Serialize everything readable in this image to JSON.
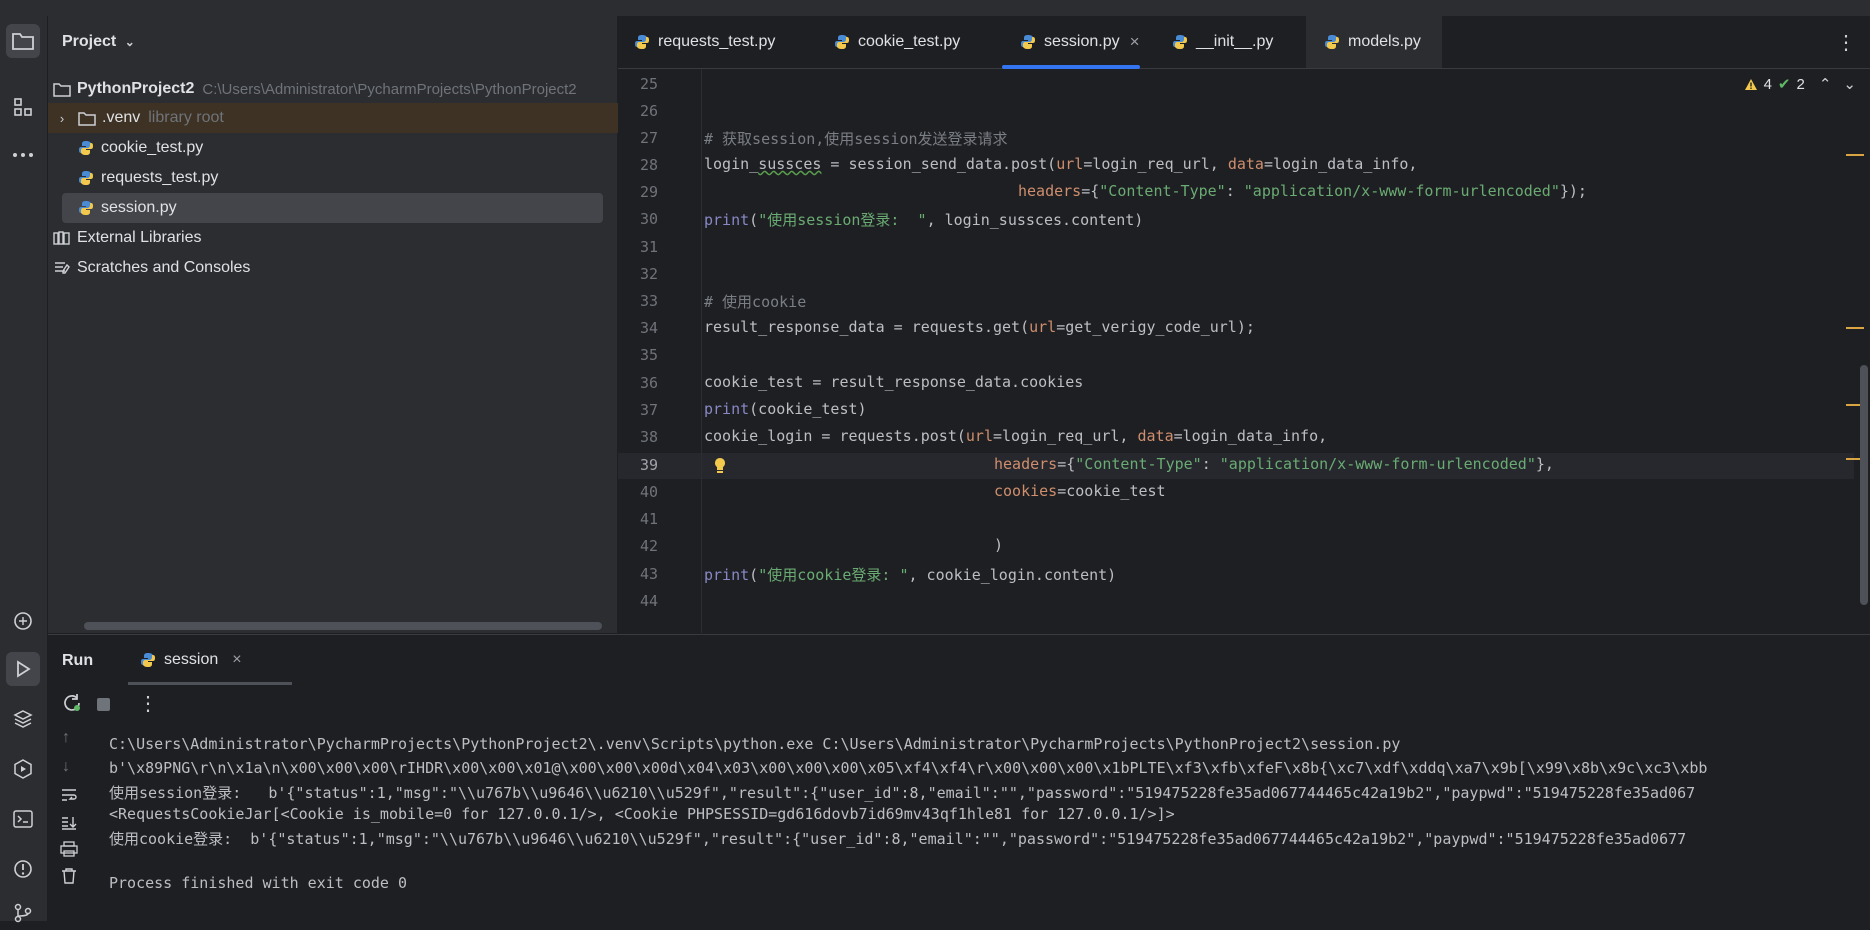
{
  "project": {
    "header": "Project",
    "root": {
      "name": "PythonProject2",
      "path": "C:\\Users\\Administrator\\PycharmProjects\\PythonProject2"
    },
    "items": [
      {
        "label": ".venv",
        "hint": "library root"
      },
      {
        "label": "cookie_test.py"
      },
      {
        "label": "requests_test.py"
      },
      {
        "label": "session.py"
      }
    ],
    "external": "External Libraries",
    "scratches": "Scratches and Consoles"
  },
  "tabs": [
    {
      "label": "requests_test.py"
    },
    {
      "label": "cookie_test.py"
    },
    {
      "label": "session.py",
      "close": "×"
    },
    {
      "label": "__init__.py"
    },
    {
      "label": "models.py"
    }
  ],
  "more_glyph": "⋮",
  "inspections": {
    "warnings": "4",
    "ok": "2"
  },
  "line_numbers": [
    "25",
    "26",
    "27",
    "28",
    "29",
    "30",
    "31",
    "32",
    "33",
    "34",
    "35",
    "36",
    "37",
    "38",
    "39",
    "40",
    "41",
    "42",
    "43",
    "44"
  ],
  "code": {
    "l27": "# 获取session,使用session发送登录请求",
    "l28_a": "login_",
    "l28_b": "sussces",
    "l28_c": " = session_send_data.post(",
    "l28_d": "url",
    "l28_e": "=login_req_url, ",
    "l28_f": "data",
    "l28_g": "=login_data_info,",
    "l29_a": "headers",
    "l29_b": "={",
    "l29_c": "\"Content-Type\"",
    "l29_d": ": ",
    "l29_e": "\"application/x-www-form-urlencoded\"",
    "l29_f": "});",
    "l30_a": "print",
    "l30_b": "(",
    "l30_c": "\"使用session登录:  \"",
    "l30_d": ", login_sussces.content)",
    "l33": "# 使用cookie",
    "l34_a": "result_response_data = requests.get(",
    "l34_b": "url",
    "l34_c": "=get_verigy_code_url);",
    "l36": "cookie_test = result_response_data.cookies",
    "l37_a": "print",
    "l37_b": "(cookie_test)",
    "l38_a": "cookie_login = requests.post(",
    "l38_b": "url",
    "l38_c": "=login_req_url, ",
    "l38_d": "data",
    "l38_e": "=login_data_info,",
    "l39_a": "headers",
    "l39_b": "={",
    "l39_c": "\"Content-Type\"",
    "l39_d": ": ",
    "l39_e": "\"application/x-www-form-urlencoded\"",
    "l39_f": "},",
    "l40_a": "cookies",
    "l40_b": "=cookie_test",
    "l42": ")",
    "l43_a": "print",
    "l43_b": "(",
    "l43_c": "\"使用cookie登录: \"",
    "l43_d": ", cookie_login.content)"
  },
  "run": {
    "title": "Run",
    "tab": "session",
    "close": "×",
    "output": [
      "C:\\Users\\Administrator\\PycharmProjects\\PythonProject2\\.venv\\Scripts\\python.exe C:\\Users\\Administrator\\PycharmProjects\\PythonProject2\\session.py",
      "b'\\x89PNG\\r\\n\\x1a\\n\\x00\\x00\\x00\\rIHDR\\x00\\x00\\x01@\\x00\\x00\\x00d\\x04\\x03\\x00\\x00\\x00\\x05\\xf4\\xf4\\r\\x00\\x00\\x00\\x1bPLTE\\xf3\\xfb\\xfeF\\x8b{\\xc7\\xdf\\xddq\\xa7\\x9b[\\x99\\x8b\\x9c\\xc3\\xbb",
      "使用session登录:   b'{\"status\":1,\"msg\":\"\\\\u767b\\\\u9646\\\\u6210\\\\u529f\",\"result\":{\"user_id\":8,\"email\":\"\",\"password\":\"519475228fe35ad067744465c42a19b2\",\"paypwd\":\"519475228fe35ad067",
      "<RequestsCookieJar[<Cookie is_mobile=0 for 127.0.0.1/>, <Cookie PHPSESSID=gd616dovb7id69mv43qf1hle81 for 127.0.0.1/>]>",
      "使用cookie登录:  b'{\"status\":1,\"msg\":\"\\\\u767b\\\\u9646\\\\u6210\\\\u529f\",\"result\":{\"user_id\":8,\"email\":\"\",\"password\":\"519475228fe35ad067744465c42a19b2\",\"paypwd\":\"519475228fe35ad0677",
      "",
      "Process finished with exit code 0"
    ]
  }
}
